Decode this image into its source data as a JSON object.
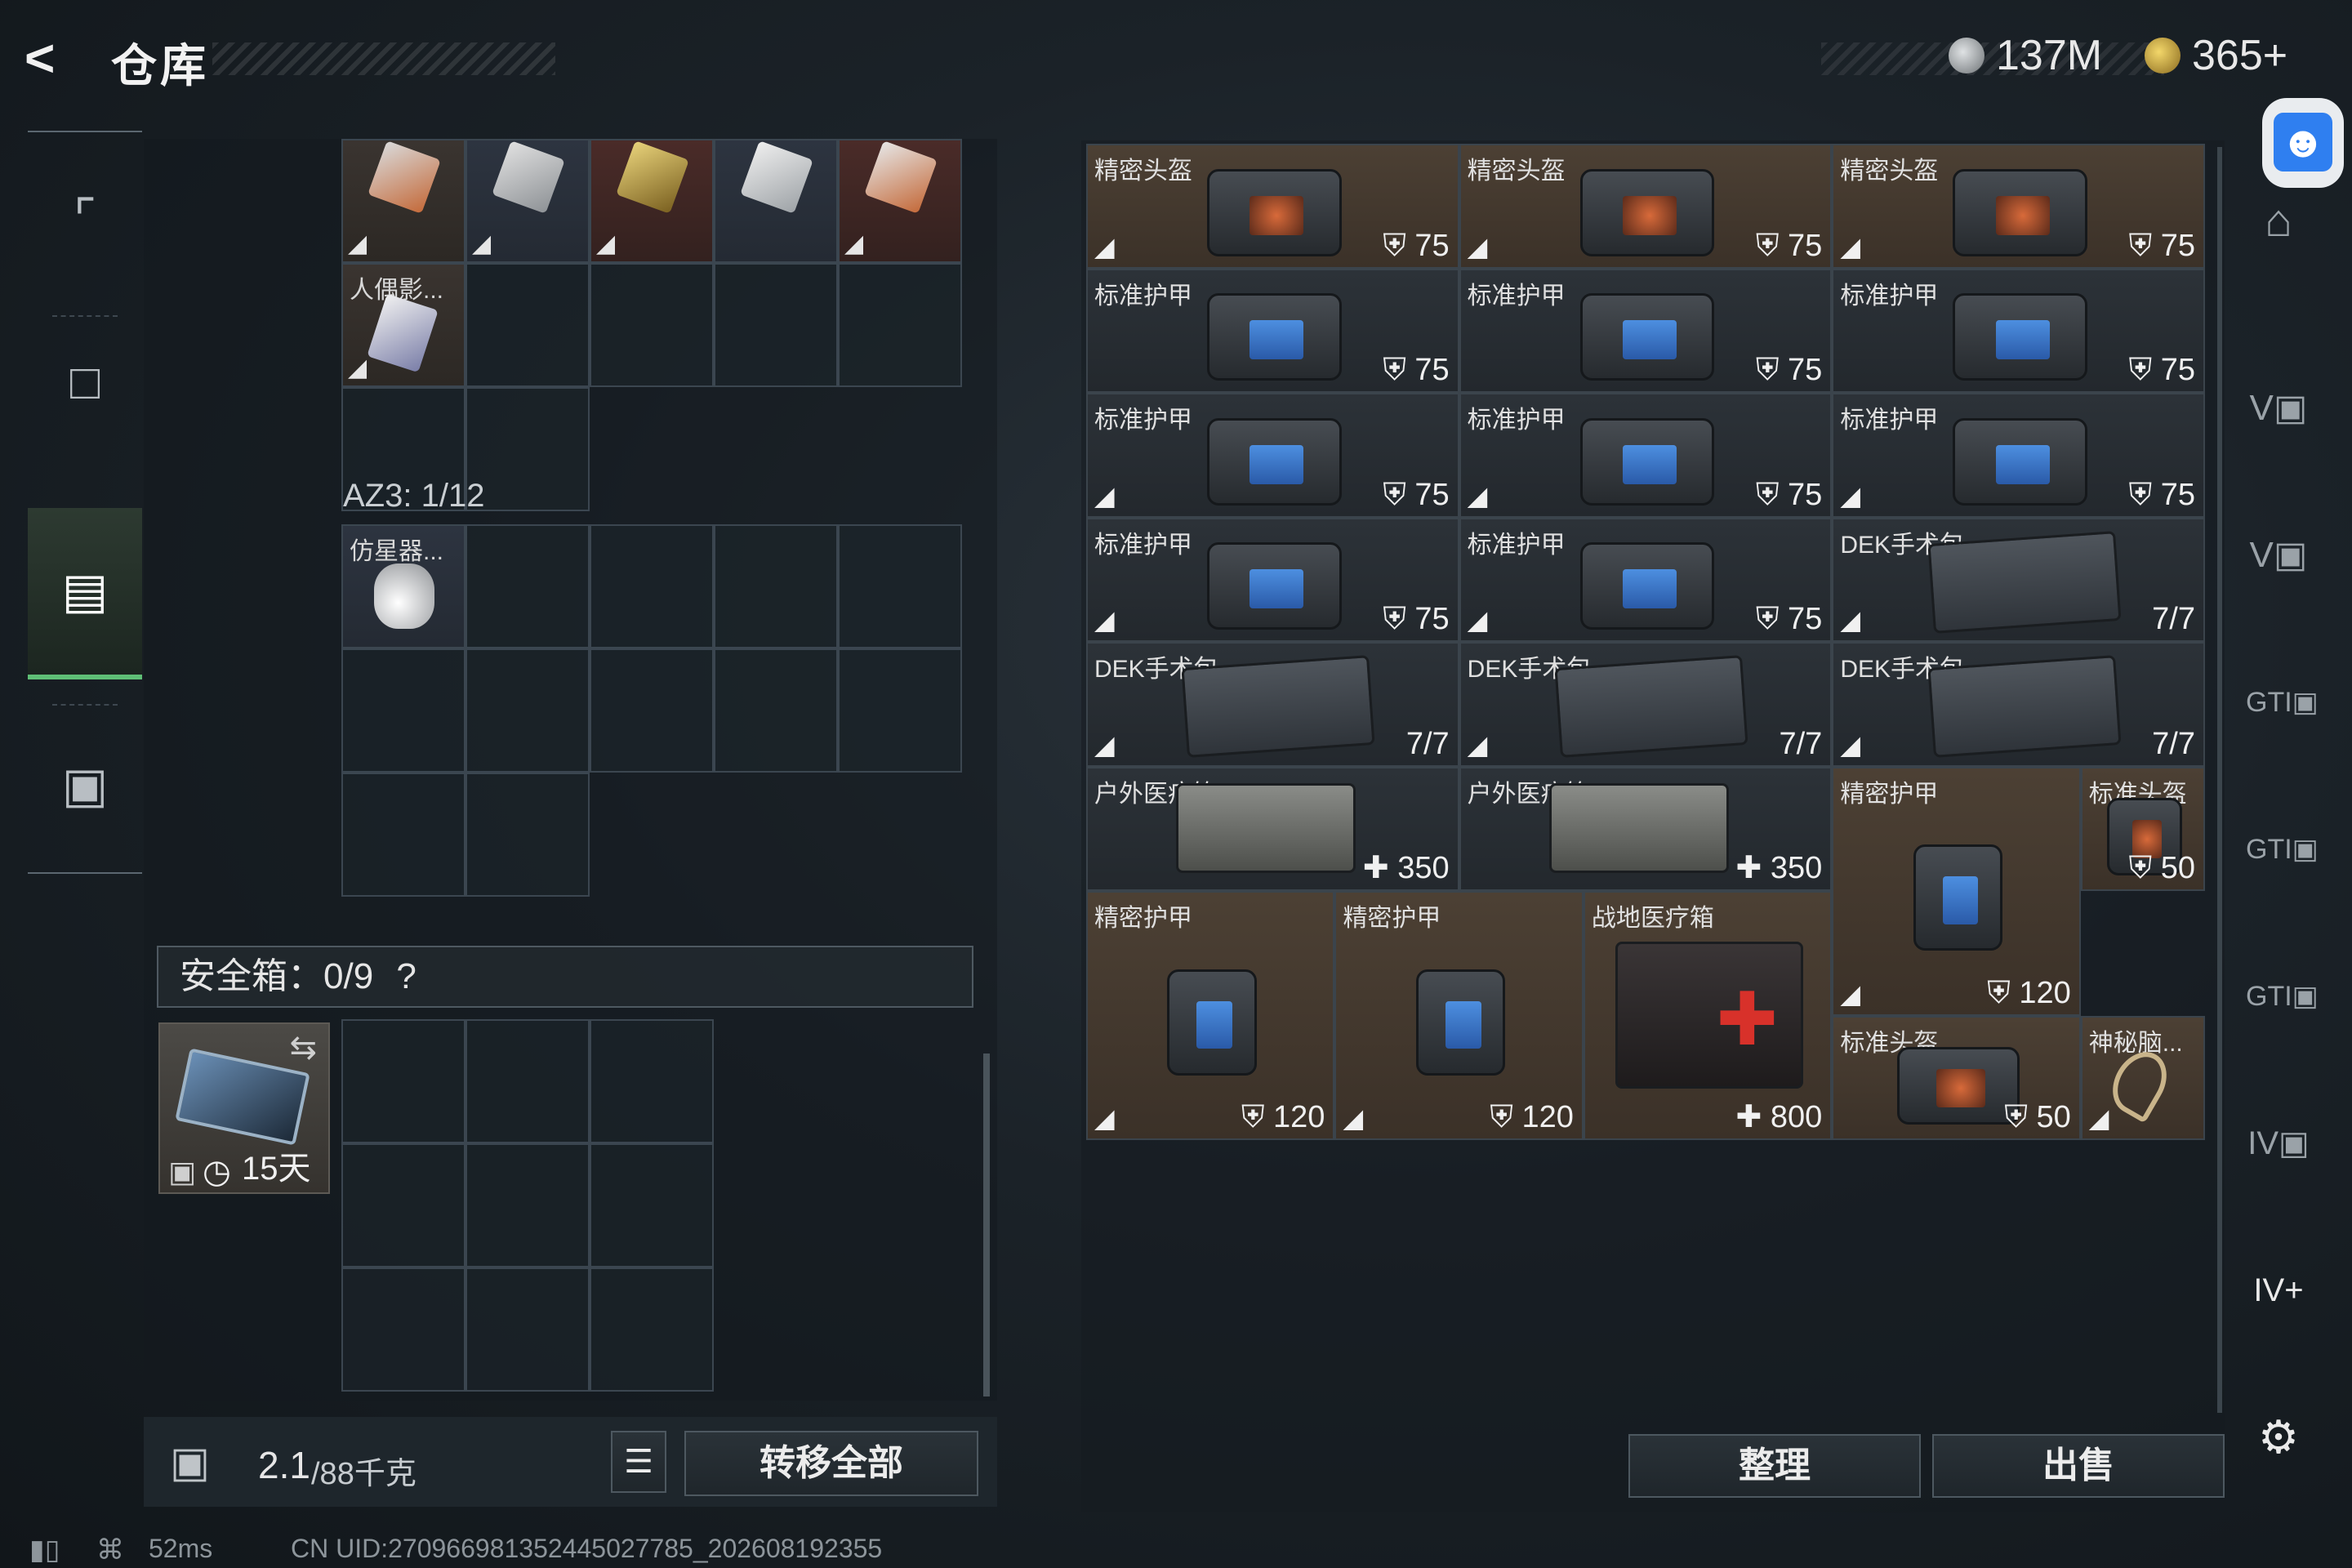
{
  "header": {
    "back_icon": "back-arrow-icon",
    "title": "仓库",
    "currency1": "137M",
    "currency2": "365+"
  },
  "left_sidebar": {
    "tabs": [
      {
        "icon": "gun-icon",
        "active": false
      },
      {
        "icon": "backpack-icon",
        "active": false
      },
      {
        "icon": "vest-icon",
        "active": true
      },
      {
        "icon": "briefcase-icon",
        "active": false
      }
    ]
  },
  "loadout": {
    "top_items": [
      "",
      "",
      "",
      "",
      ""
    ],
    "item_renying": "人偶影...",
    "az3_label": "AZ3: 1/12",
    "item_fangxing": "仿星器...",
    "safe_box_label": "安全箱：0/9",
    "safe_box_help": "?",
    "safe_item_days": "15天",
    "weight": "2.1",
    "weight_max": "/88千克",
    "transfer_all": "转移全部"
  },
  "stash": {
    "items": [
      {
        "name": "精密头盔",
        "value": "75",
        "badge": "shield"
      },
      {
        "name": "精密头盔",
        "value": "75",
        "badge": "shield"
      },
      {
        "name": "精密头盔",
        "value": "75",
        "badge": "shield"
      },
      {
        "name": "标准护甲",
        "value": "75",
        "badge": "shield"
      },
      {
        "name": "标准护甲",
        "value": "75",
        "badge": "shield"
      },
      {
        "name": "标准护甲",
        "value": "75",
        "badge": "shield"
      },
      {
        "name": "标准护甲",
        "value": "75",
        "badge": "shield"
      },
      {
        "name": "标准护甲",
        "value": "75",
        "badge": "shield"
      },
      {
        "name": "标准护甲",
        "value": "75",
        "badge": "shield"
      },
      {
        "name": "标准护甲",
        "value": "75",
        "badge": "shield"
      },
      {
        "name": "标准护甲",
        "value": "75",
        "badge": "shield"
      },
      {
        "name": "DEK手术包",
        "value": "7/7",
        "badge": "none"
      },
      {
        "name": "DEK手术包",
        "value": "7/7",
        "badge": "none"
      },
      {
        "name": "DEK手术包",
        "value": "7/7",
        "badge": "none"
      },
      {
        "name": "DEK手术包",
        "value": "7/7",
        "badge": "none"
      },
      {
        "name": "户外医疗箱",
        "value": "350",
        "badge": "plus"
      },
      {
        "name": "户外医疗箱",
        "value": "350",
        "badge": "plus"
      },
      {
        "name": "精密护甲",
        "value": "120",
        "badge": "shield"
      },
      {
        "name": "标准头盔",
        "value": "50",
        "badge": "shield"
      },
      {
        "name": "精密护甲",
        "value": "120",
        "badge": "shield"
      },
      {
        "name": "精密护甲",
        "value": "120",
        "badge": "shield"
      },
      {
        "name": "战地医疗箱",
        "value": "800",
        "badge": "plus"
      },
      {
        "name": "标准头盔",
        "value": "50",
        "badge": "shield"
      },
      {
        "name": "神秘脑...",
        "value": "",
        "badge": "none"
      }
    ],
    "sort_button": "整理",
    "sell_button": "出售"
  },
  "right_sidebar": {
    "icons": [
      "stash-home-icon",
      "case-v-icon",
      "case-v-icon",
      "case-gti-icon",
      "case-gti-icon",
      "case-gti-icon",
      "case-iv-icon",
      "case-iv-add-icon",
      "settings-icon"
    ]
  },
  "status_bar": {
    "ping": "52ms",
    "uid": "CN UID:270966981352445027785_202608192355"
  },
  "colors": {
    "active_tab": "#5fbf76",
    "accessibility": "#2f7ff0",
    "brown_cell": "#4c4034"
  }
}
